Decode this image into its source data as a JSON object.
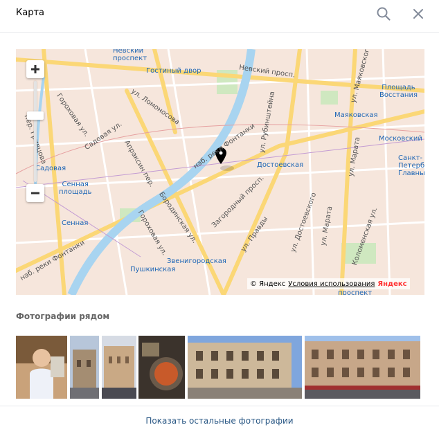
{
  "header": {
    "title": "Карта",
    "search_icon": "search-icon",
    "close_icon": "close-icon"
  },
  "map": {
    "labels": {
      "nevsky_prospekt_metro": "Невский\nпроспект",
      "gostiny_dvor": "Гостиный двор",
      "nevsky_prosp": "Невский просп.",
      "ploshchad_vosstaniya": "Площадь\nВосстания",
      "mayakovskaya": "Маяковская",
      "moskovsky": "Московский",
      "sankt_peterburg": "Санкт-\nПетербу\nГлавны",
      "ul_lomonosova": "ул. Ломоносова",
      "sadovaya_ul": "Садовая ул.",
      "gorokhovaya_ul": "Гороховая ул.",
      "per_grivtsova": "пер. Гривцова",
      "sadovaya": "Садовая",
      "sennaya_ploshchad": "Сенная\nплощадь",
      "sennaya": "Сенная",
      "apraksin_per": "Апраксин пер.",
      "nab_reki_fontanki": "наб. реки Фонтанки",
      "ul_rubinshteyna": "ул. Рубинштейна",
      "dostoevskaya": "Достоевская",
      "zagorodny_prosp": "Загородный просп.",
      "ul_pravdy": "ул. Правды",
      "borodinskaya_ul": "Бородинская ул.",
      "ul_dostoevskogo": "ул. Достоевского",
      "ul_marata_1": "ул. Марата",
      "ul_marata_2": "ул. Марата",
      "kolomenskaya_ul": "Коломенская ул.",
      "ul_mayakovskogo": "ул. Маяковского",
      "gorokhovaya_ul_2": "Гороховая ул.",
      "nab_reki_fontanki_2": "наб. реки Фонтанки",
      "zvenigorodskaya": "Звенигородская",
      "pushkinskaya": "Пушкинская",
      "prospekt_bottom": "проспект"
    },
    "attribution": {
      "copyright": "© Яндекс",
      "terms": "Условия использования",
      "brand": "Яндекс"
    },
    "controls": {
      "zoom_in": "plus-icon",
      "zoom_out": "minus-icon"
    }
  },
  "photos_section": {
    "title": "Фотографии рядом"
  },
  "show_more": "Показать остальные фотографии",
  "colors": {
    "accent_link": "#2a5885",
    "metro_blue": "#1e66b5",
    "water": "#a8d4f0",
    "road_yellow": "#fbd776",
    "park_green": "#cfe8c0"
  }
}
